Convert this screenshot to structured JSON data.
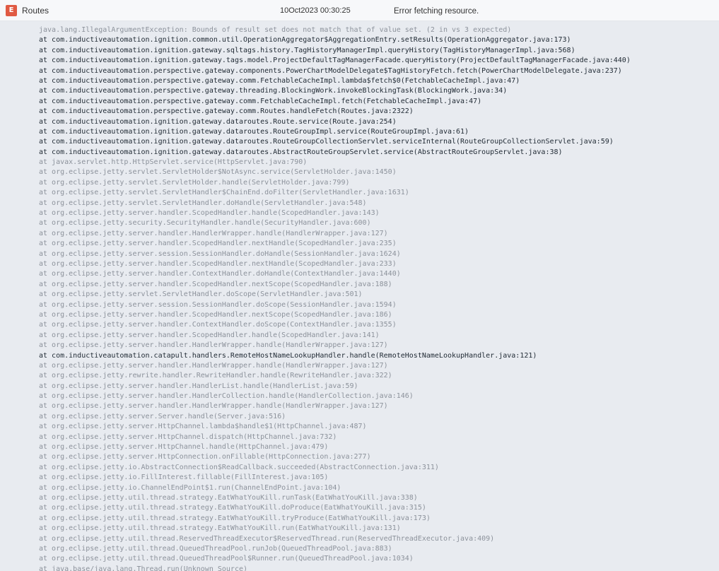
{
  "log_entry": {
    "level": "E",
    "logger": "Routes",
    "timestamp": "10Oct2023 00:30:25",
    "message": "Error fetching resource.",
    "colors": {
      "error_badge": "#e05a43",
      "header_bg": "#f7f8fa",
      "stack_bg": "#e8ebf0",
      "app_frame_text": "#1f2933",
      "library_frame_text": "#8c929b"
    }
  },
  "stack_trace": [
    {
      "text": "java.lang.IllegalArgumentException: Bounds of result set does not match that of value set. (2 in vs 3 expected)",
      "app": false
    },
    {
      "text": "at com.inductiveautomation.ignition.common.util.OperationAggregator$AggregationEntry.setResults(OperationAggregator.java:173)",
      "app": true
    },
    {
      "text": "at com.inductiveautomation.ignition.gateway.sqltags.history.TagHistoryManagerImpl.queryHistory(TagHistoryManagerImpl.java:568)",
      "app": true
    },
    {
      "text": "at com.inductiveautomation.ignition.gateway.tags.model.ProjectDefaultTagManagerFacade.queryHistory(ProjectDefaultTagManagerFacade.java:440)",
      "app": true
    },
    {
      "text": "at com.inductiveautomation.perspective.gateway.components.PowerChartModelDelegate$TagHistoryFetch.fetch(PowerChartModelDelegate.java:237)",
      "app": true
    },
    {
      "text": "at com.inductiveautomation.perspective.gateway.comm.FetchableCacheImpl.lambda$fetch$0(FetchableCacheImpl.java:47)",
      "app": true
    },
    {
      "text": "at com.inductiveautomation.perspective.gateway.threading.BlockingWork.invokeBlockingTask(BlockingWork.java:34)",
      "app": true
    },
    {
      "text": "at com.inductiveautomation.perspective.gateway.comm.FetchableCacheImpl.fetch(FetchableCacheImpl.java:47)",
      "app": true
    },
    {
      "text": "at com.inductiveautomation.perspective.gateway.comm.Routes.handleFetch(Routes.java:2322)",
      "app": true
    },
    {
      "text": "at com.inductiveautomation.ignition.gateway.dataroutes.Route.service(Route.java:254)",
      "app": true
    },
    {
      "text": "at com.inductiveautomation.ignition.gateway.dataroutes.RouteGroupImpl.service(RouteGroupImpl.java:61)",
      "app": true
    },
    {
      "text": "at com.inductiveautomation.ignition.gateway.dataroutes.RouteGroupCollectionServlet.serviceInternal(RouteGroupCollectionServlet.java:59)",
      "app": true
    },
    {
      "text": "at com.inductiveautomation.ignition.gateway.dataroutes.AbstractRouteGroupServlet.service(AbstractRouteGroupServlet.java:38)",
      "app": true
    },
    {
      "text": "at javax.servlet.http.HttpServlet.service(HttpServlet.java:790)",
      "app": false
    },
    {
      "text": "at org.eclipse.jetty.servlet.ServletHolder$NotAsync.service(ServletHolder.java:1450)",
      "app": false
    },
    {
      "text": "at org.eclipse.jetty.servlet.ServletHolder.handle(ServletHolder.java:799)",
      "app": false
    },
    {
      "text": "at org.eclipse.jetty.servlet.ServletHandler$ChainEnd.doFilter(ServletHandler.java:1631)",
      "app": false
    },
    {
      "text": "at org.eclipse.jetty.servlet.ServletHandler.doHandle(ServletHandler.java:548)",
      "app": false
    },
    {
      "text": "at org.eclipse.jetty.server.handler.ScopedHandler.handle(ScopedHandler.java:143)",
      "app": false
    },
    {
      "text": "at org.eclipse.jetty.security.SecurityHandler.handle(SecurityHandler.java:600)",
      "app": false
    },
    {
      "text": "at org.eclipse.jetty.server.handler.HandlerWrapper.handle(HandlerWrapper.java:127)",
      "app": false
    },
    {
      "text": "at org.eclipse.jetty.server.handler.ScopedHandler.nextHandle(ScopedHandler.java:235)",
      "app": false
    },
    {
      "text": "at org.eclipse.jetty.server.session.SessionHandler.doHandle(SessionHandler.java:1624)",
      "app": false
    },
    {
      "text": "at org.eclipse.jetty.server.handler.ScopedHandler.nextHandle(ScopedHandler.java:233)",
      "app": false
    },
    {
      "text": "at org.eclipse.jetty.server.handler.ContextHandler.doHandle(ContextHandler.java:1440)",
      "app": false
    },
    {
      "text": "at org.eclipse.jetty.server.handler.ScopedHandler.nextScope(ScopedHandler.java:188)",
      "app": false
    },
    {
      "text": "at org.eclipse.jetty.servlet.ServletHandler.doScope(ServletHandler.java:501)",
      "app": false
    },
    {
      "text": "at org.eclipse.jetty.server.session.SessionHandler.doScope(SessionHandler.java:1594)",
      "app": false
    },
    {
      "text": "at org.eclipse.jetty.server.handler.ScopedHandler.nextScope(ScopedHandler.java:186)",
      "app": false
    },
    {
      "text": "at org.eclipse.jetty.server.handler.ContextHandler.doScope(ContextHandler.java:1355)",
      "app": false
    },
    {
      "text": "at org.eclipse.jetty.server.handler.ScopedHandler.handle(ScopedHandler.java:141)",
      "app": false
    },
    {
      "text": "at org.eclipse.jetty.server.handler.HandlerWrapper.handle(HandlerWrapper.java:127)",
      "app": false
    },
    {
      "text": "at com.inductiveautomation.catapult.handlers.RemoteHostNameLookupHandler.handle(RemoteHostNameLookupHandler.java:121)",
      "app": true
    },
    {
      "text": "at org.eclipse.jetty.server.handler.HandlerWrapper.handle(HandlerWrapper.java:127)",
      "app": false
    },
    {
      "text": "at org.eclipse.jetty.rewrite.handler.RewriteHandler.handle(RewriteHandler.java:322)",
      "app": false
    },
    {
      "text": "at org.eclipse.jetty.server.handler.HandlerList.handle(HandlerList.java:59)",
      "app": false
    },
    {
      "text": "at org.eclipse.jetty.server.handler.HandlerCollection.handle(HandlerCollection.java:146)",
      "app": false
    },
    {
      "text": "at org.eclipse.jetty.server.handler.HandlerWrapper.handle(HandlerWrapper.java:127)",
      "app": false
    },
    {
      "text": "at org.eclipse.jetty.server.Server.handle(Server.java:516)",
      "app": false
    },
    {
      "text": "at org.eclipse.jetty.server.HttpChannel.lambda$handle$1(HttpChannel.java:487)",
      "app": false
    },
    {
      "text": "at org.eclipse.jetty.server.HttpChannel.dispatch(HttpChannel.java:732)",
      "app": false
    },
    {
      "text": "at org.eclipse.jetty.server.HttpChannel.handle(HttpChannel.java:479)",
      "app": false
    },
    {
      "text": "at org.eclipse.jetty.server.HttpConnection.onFillable(HttpConnection.java:277)",
      "app": false
    },
    {
      "text": "at org.eclipse.jetty.io.AbstractConnection$ReadCallback.succeeded(AbstractConnection.java:311)",
      "app": false
    },
    {
      "text": "at org.eclipse.jetty.io.FillInterest.fillable(FillInterest.java:105)",
      "app": false
    },
    {
      "text": "at org.eclipse.jetty.io.ChannelEndPoint$1.run(ChannelEndPoint.java:104)",
      "app": false
    },
    {
      "text": "at org.eclipse.jetty.util.thread.strategy.EatWhatYouKill.runTask(EatWhatYouKill.java:338)",
      "app": false
    },
    {
      "text": "at org.eclipse.jetty.util.thread.strategy.EatWhatYouKill.doProduce(EatWhatYouKill.java:315)",
      "app": false
    },
    {
      "text": "at org.eclipse.jetty.util.thread.strategy.EatWhatYouKill.tryProduce(EatWhatYouKill.java:173)",
      "app": false
    },
    {
      "text": "at org.eclipse.jetty.util.thread.strategy.EatWhatYouKill.run(EatWhatYouKill.java:131)",
      "app": false
    },
    {
      "text": "at org.eclipse.jetty.util.thread.ReservedThreadExecutor$ReservedThread.run(ReservedThreadExecutor.java:409)",
      "app": false
    },
    {
      "text": "at org.eclipse.jetty.util.thread.QueuedThreadPool.runJob(QueuedThreadPool.java:883)",
      "app": false
    },
    {
      "text": "at org.eclipse.jetty.util.thread.QueuedThreadPool$Runner.run(QueuedThreadPool.java:1034)",
      "app": false
    },
    {
      "text": "at java.base/java.lang.Thread.run(Unknown Source)",
      "app": false
    }
  ]
}
